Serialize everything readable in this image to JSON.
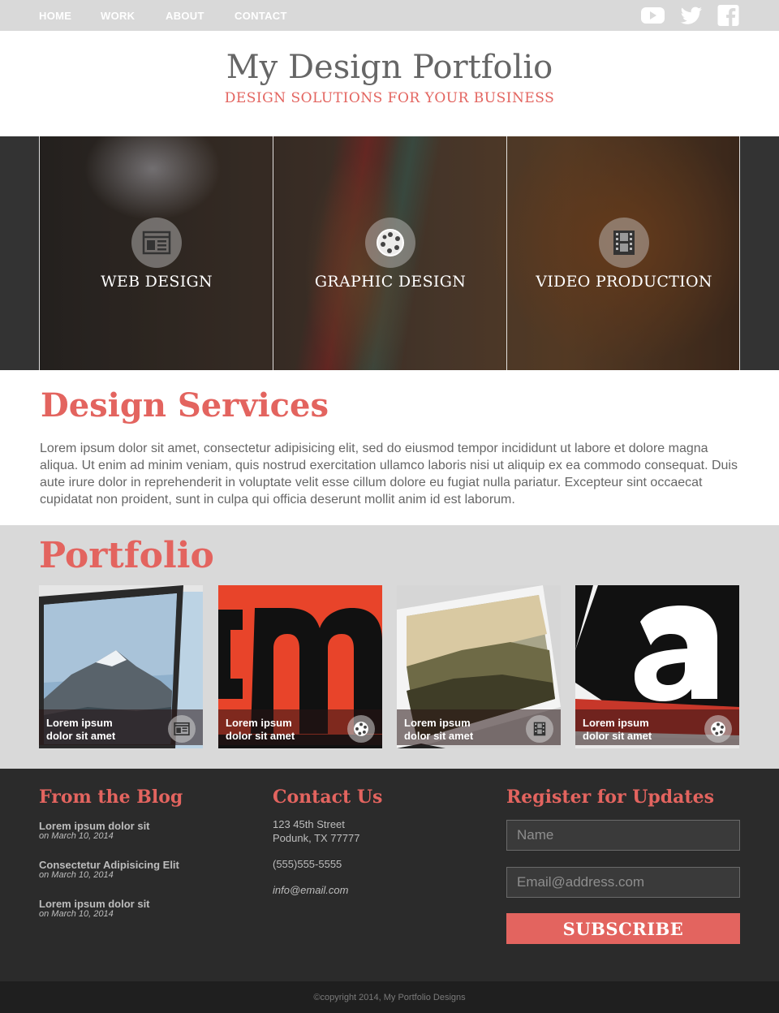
{
  "nav": {
    "items": [
      {
        "label": "HOME"
      },
      {
        "label": "WORK"
      },
      {
        "label": "ABOUT"
      },
      {
        "label": "CONTACT"
      }
    ],
    "social": [
      "youtube-icon",
      "twitter-icon",
      "facebook-icon"
    ]
  },
  "header": {
    "title": "My Design Portfolio",
    "tagline": "DESIGN SOLUTIONS FOR YOUR BUSINESS"
  },
  "hero": {
    "panels": [
      {
        "label": "WEB DESIGN",
        "icon": "browser-window-icon"
      },
      {
        "label": "GRAPHIC DESIGN",
        "icon": "palette-icon"
      },
      {
        "label": "VIDEO PRODUCTION",
        "icon": "film-strip-icon"
      }
    ]
  },
  "services": {
    "title": "Design Services",
    "body": "Lorem ipsum dolor sit amet, consectetur adipisicing elit, sed do eiusmod tempor incididunt ut labore et dolore magna aliqua. Ut enim ad minim veniam, quis nostrud exercitation ullamco laboris nisi ut aliquip ex ea commodo consequat. Duis aute irure dolor in reprehenderit in voluptate velit esse cillum dolore eu fugiat nulla pariatur. Excepteur sint occaecat cupidatat non proident, sunt in culpa qui officia deserunt mollit anim id est laborum."
  },
  "portfolio": {
    "title": "Portfolio",
    "items": [
      {
        "line1": "Lorem ipsum",
        "line2": "dolor sit amet",
        "icon": "browser-window-icon"
      },
      {
        "line1": "Lorem ipsum",
        "line2": "dolor sit amet",
        "icon": "palette-icon"
      },
      {
        "line1": "Lorem ipsum",
        "line2": "dolor sit amet",
        "icon": "film-strip-icon"
      },
      {
        "line1": "Lorem ipsum",
        "line2": "dolor sit amet",
        "icon": "palette-icon"
      }
    ]
  },
  "footer": {
    "blog": {
      "title": "From the Blog",
      "posts": [
        {
          "title": "Lorem ipsum dolor sit",
          "date": "on March 10, 2014"
        },
        {
          "title": "Consectetur Adipisicing Elit",
          "date": "on March 10, 2014"
        },
        {
          "title": "Lorem ipsum dolor sit",
          "date": "on March 10, 2014"
        }
      ]
    },
    "contact": {
      "title": "Contact Us",
      "street": "123 45th Street",
      "city": "Podunk, TX 77777",
      "phone": "(555)555-5555",
      "email": "info@email.com"
    },
    "register": {
      "title": "Register for Updates",
      "name_placeholder": "Name",
      "email_placeholder": "Email@address.com",
      "button_label": "SUBSCRIBE"
    },
    "copyright": "©copyright 2014, My Portfolio Designs"
  },
  "colors": {
    "accent": "#e3645f",
    "nav_bg": "#d9d9d9",
    "footer_bg": "#2b2b2b"
  }
}
